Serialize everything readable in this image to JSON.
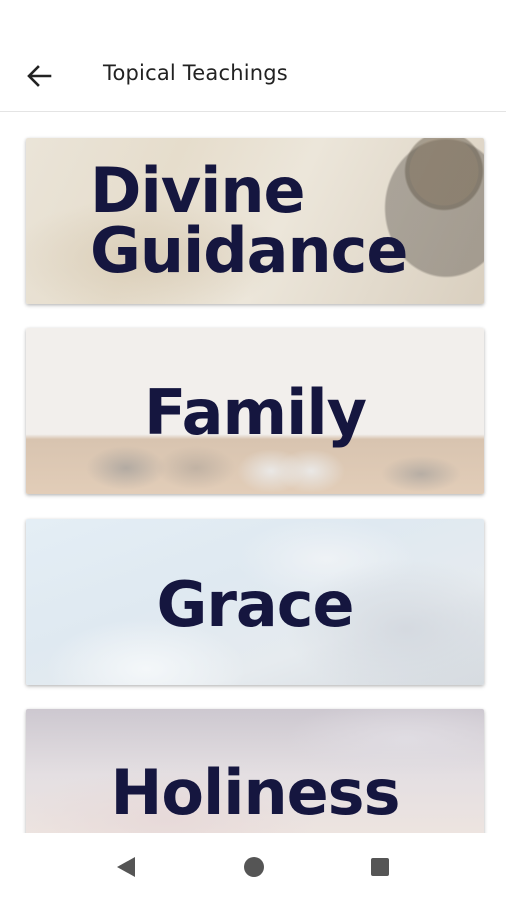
{
  "app_bar": {
    "title": "Topical Teachings",
    "back_icon": "arrow-left-icon"
  },
  "topics": [
    {
      "title_line1": "Divine",
      "title_line2": "Guidance",
      "background": "map-compass-image"
    },
    {
      "title": "Family",
      "background": "shoes-image"
    },
    {
      "title": "Grace",
      "background": "clouds-image"
    },
    {
      "title": "Holiness",
      "background": "sunset-clouds-image"
    }
  ],
  "nav_bar": {
    "back_icon": "triangle-back-icon",
    "home_icon": "circle-home-icon",
    "recent_icon": "square-recents-icon"
  },
  "colors": {
    "title_text": "#15163f",
    "app_bar_text": "#222222",
    "nav_icon": "#555555"
  }
}
